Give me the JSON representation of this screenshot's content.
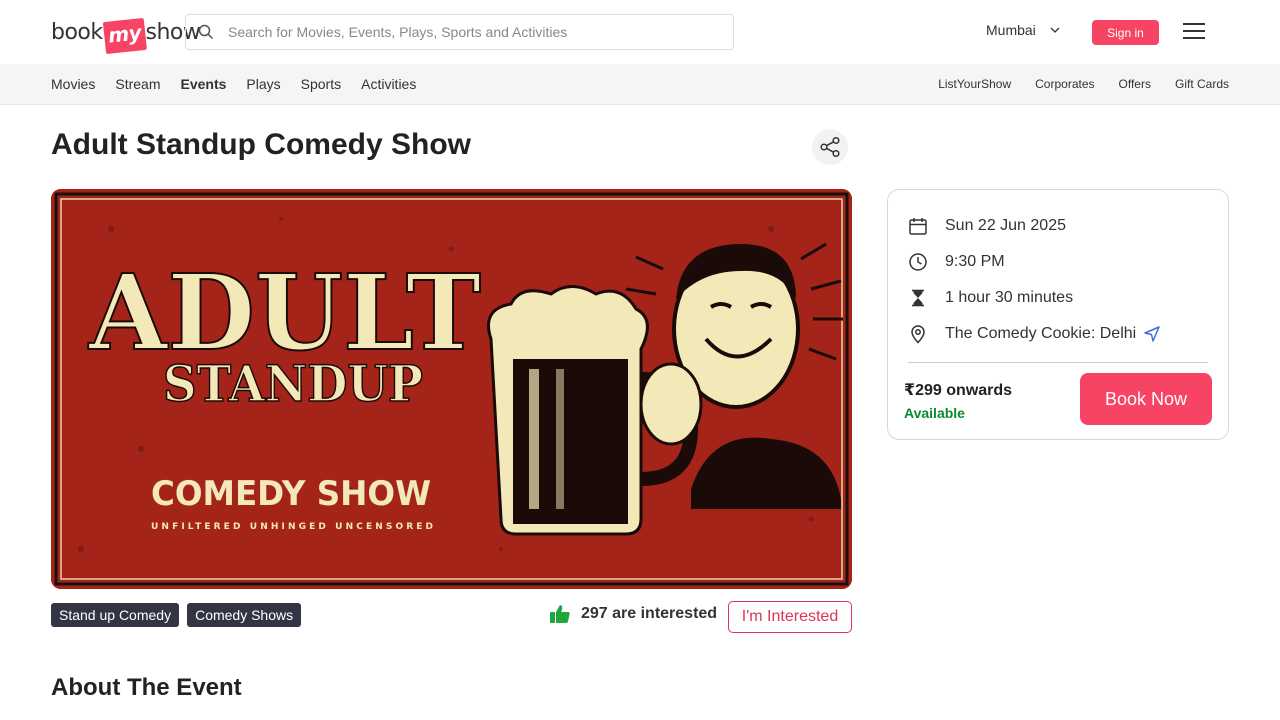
{
  "header": {
    "logo_left": "book",
    "logo_mid": "my",
    "logo_right": "show",
    "search_placeholder": "Search for Movies, Events, Plays, Sports and Activities",
    "city": "Mumbai",
    "signin_label": "Sign in"
  },
  "nav": {
    "left": [
      "Movies",
      "Stream",
      "Events",
      "Plays",
      "Sports",
      "Activities"
    ],
    "active": "Events",
    "right": [
      "ListYourShow",
      "Corporates",
      "Offers",
      "Gift Cards"
    ]
  },
  "event": {
    "title": "Adult Standup Comedy Show",
    "tags": [
      "Stand up Comedy",
      "Comedy Shows"
    ],
    "interested_count": "297 are interested",
    "interested_button": "I'm Interested"
  },
  "poster": {
    "line1": "ADULT",
    "line2": "STANDUP",
    "line3": "COMEDY SHOW",
    "line4": "UNFILTERED   UNHINGED   UNCENSORED"
  },
  "details": {
    "date": "Sun 22 Jun 2025",
    "time": "9:30 PM",
    "duration": "1 hour 30 minutes",
    "venue": "The Comedy Cookie: Delhi",
    "price": "₹299 onwards",
    "availability": "Available",
    "book_label": "Book Now"
  },
  "about_heading": "About The Event",
  "colors": {
    "brand": "#f84464",
    "tag_bg": "#333545",
    "available": "#0a8a2c",
    "poster_bg": "#a5241a",
    "poster_text": "#f3e9b8"
  }
}
